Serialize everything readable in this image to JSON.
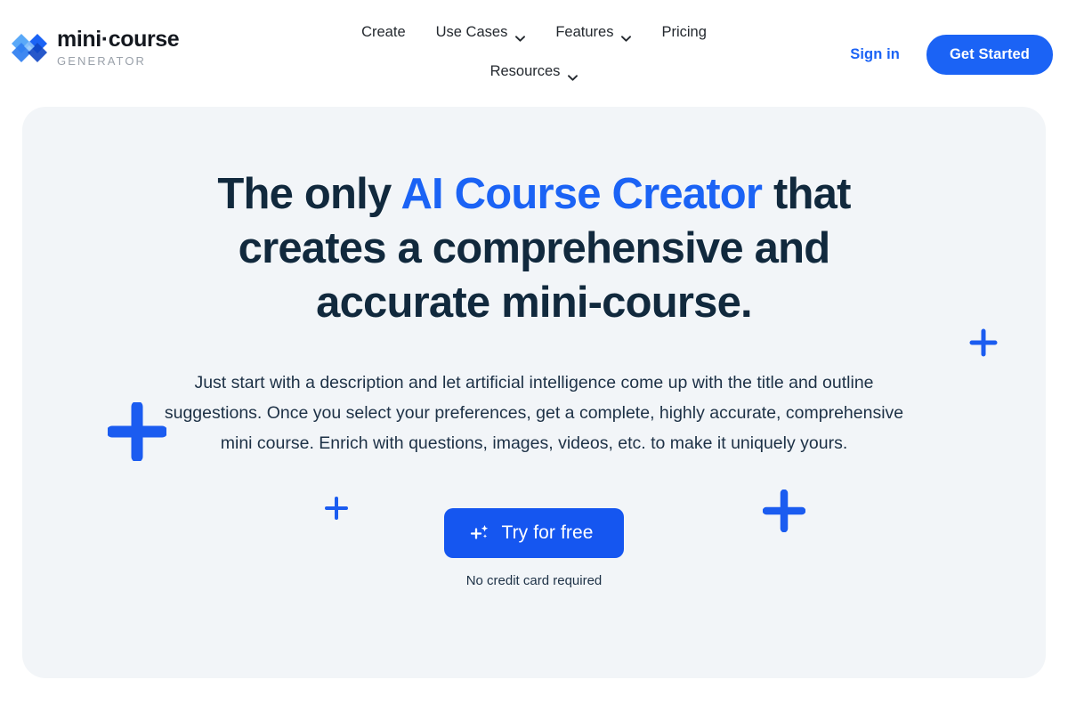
{
  "brand": {
    "name": "mini·course",
    "tagline": "GENERATOR",
    "logo_icon": "minicourse-diamond-logo-icon",
    "logo_colors": [
      "#1b63f5",
      "#5aa9f8",
      "#8ec6fb",
      "#0f46c4"
    ]
  },
  "nav": {
    "items": [
      {
        "label": "Create",
        "has_dropdown": false,
        "icon": null
      },
      {
        "label": "Use Cases",
        "has_dropdown": true,
        "icon": "chevron-down-icon"
      },
      {
        "label": "Features",
        "has_dropdown": true,
        "icon": "chevron-down-icon"
      },
      {
        "label": "Pricing",
        "has_dropdown": false,
        "icon": null
      },
      {
        "label": "Resources",
        "has_dropdown": true,
        "icon": "chevron-down-icon"
      }
    ]
  },
  "header_actions": {
    "signin_label": "Sign in",
    "get_started_label": "Get Started"
  },
  "hero": {
    "headline": {
      "part1": "The only ",
      "accent": "AI Course Creator",
      "part2": " that creates a comprehensive and accurate mini-course."
    },
    "subtext": "Just start with a description and let artificial intelligence come up with the title and outline suggestions. Once you select your preferences, get a complete, highly accurate, comprehensive mini course. Enrich with questions, images, videos, etc. to make it uniquely yours.",
    "cta_label": "Try for free",
    "cta_icon": "sparkle-plus-icon",
    "cta_note": "No credit card required",
    "decorations": [
      {
        "name": "plus-decoration-large-left",
        "icon": "plus-icon"
      },
      {
        "name": "plus-decoration-small-center",
        "icon": "plus-icon"
      },
      {
        "name": "plus-decoration-medium-right",
        "icon": "plus-icon"
      },
      {
        "name": "plus-decoration-small-top-right",
        "icon": "plus-icon"
      }
    ]
  },
  "colors": {
    "accent_blue": "#1b63f5",
    "cta_blue": "#1556f0",
    "headline_navy": "#11293d",
    "card_bg": "#f2f5f8",
    "page_bg": "#ffffff",
    "muted_gray": "#9aa1aa"
  }
}
